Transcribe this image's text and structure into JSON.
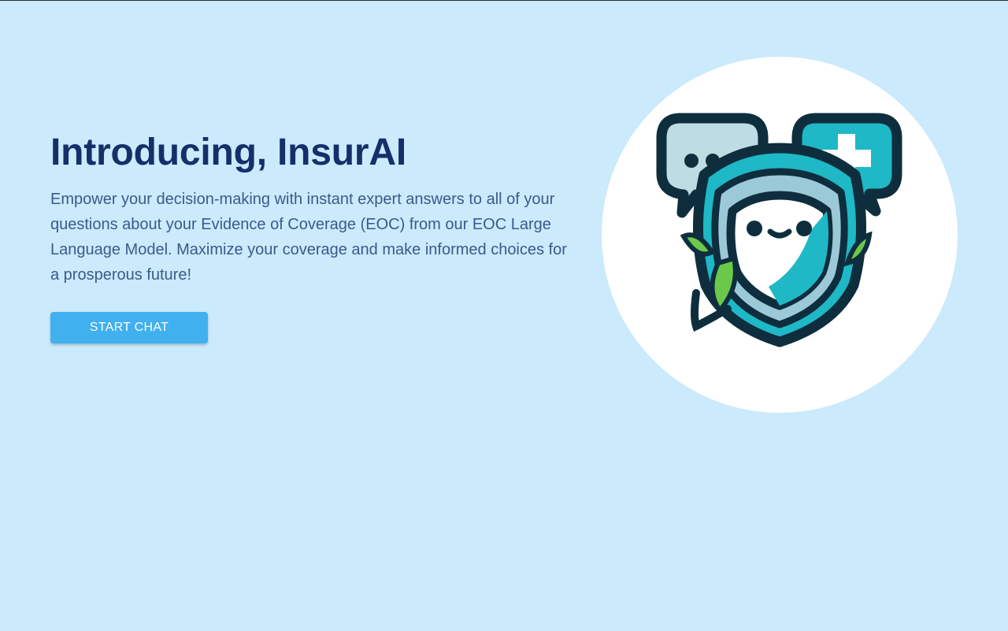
{
  "hero": {
    "title": "Introducing, InsurAI",
    "description": "Empower your decision-making with instant expert answers to all of your questions about your Evidence of Coverage (EOC) from our EOC Large Language Model. Maximize your coverage and make informed choices for a prosperous future!",
    "cta_label": "START CHAT"
  },
  "logo": {
    "icon": "shield-mascot-chat-icon"
  },
  "colors": {
    "background": "#cbeafb",
    "title": "#14306a",
    "body_text": "#3b5a8c",
    "button": "#41b0ef",
    "button_text": "#ffffff",
    "logo_outline": "#0e2e3e",
    "logo_teal": "#1fb8c6",
    "logo_leaf": "#6cc84a"
  }
}
